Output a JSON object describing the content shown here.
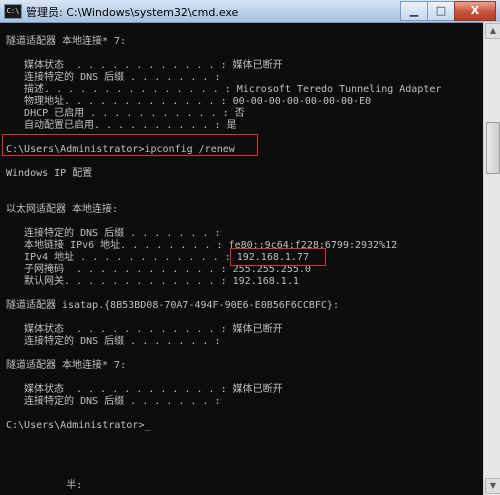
{
  "window": {
    "title": "管理员: C:\\Windows\\system32\\cmd.exe",
    "icon": "cmd-icon",
    "controls": {
      "minimize": "▁",
      "maximize": "□",
      "close": "X"
    }
  },
  "console": {
    "lines": [
      "隧道适配器 本地连接* 7:",
      "",
      "   媒体状态  . . . . . . . . . . . . : 媒体已断开",
      "   连接特定的 DNS 后缀 . . . . . . . :",
      "   描述. . . . . . . . . . . . . . . : Microsoft Teredo Tunneling Adapter",
      "   物理地址. . . . . . . . . . . . . : 00-00-00-00-00-00-00-E0",
      "   DHCP 已启用 . . . . . . . . . . . : 否",
      "   自动配置已启用. . . . . . . . . . : 是",
      "",
      "C:\\Users\\Administrator>ipconfig /renew",
      "",
      "Windows IP 配置",
      "",
      "",
      "以太网适配器 本地连接:",
      "",
      "   连接特定的 DNS 后缀 . . . . . . . :",
      "   本地链接 IPv6 地址. . . . . . . . : fe80::9c64:f228:6799:2932%12",
      "   IPv4 地址 . . . . . . . . . . . . : 192.168.1.77",
      "   子网掩码  . . . . . . . . . . . . : 255.255.255.0",
      "   默认网关. . . . . . . . . . . . . : 192.168.1.1",
      "",
      "隧道适配器 isatap.{8B53BD08-70A7-494F-90E6-E0B56F6CCBFC}:",
      "",
      "   媒体状态  . . . . . . . . . . . . : 媒体已断开",
      "   连接特定的 DNS 后缀 . . . . . . . :",
      "",
      "隧道适配器 本地连接* 7:",
      "",
      "   媒体状态  . . . . . . . . . . . . : 媒体已断开",
      "   连接特定的 DNS 后缀 . . . . . . . :",
      "",
      "C:\\Users\\Administrator>_",
      "",
      "",
      "",
      "",
      "          半:"
    ]
  },
  "colors": {
    "highlight": "#e0303a",
    "console_bg": "#0c0c0c",
    "console_fg": "#c0c0c0"
  }
}
